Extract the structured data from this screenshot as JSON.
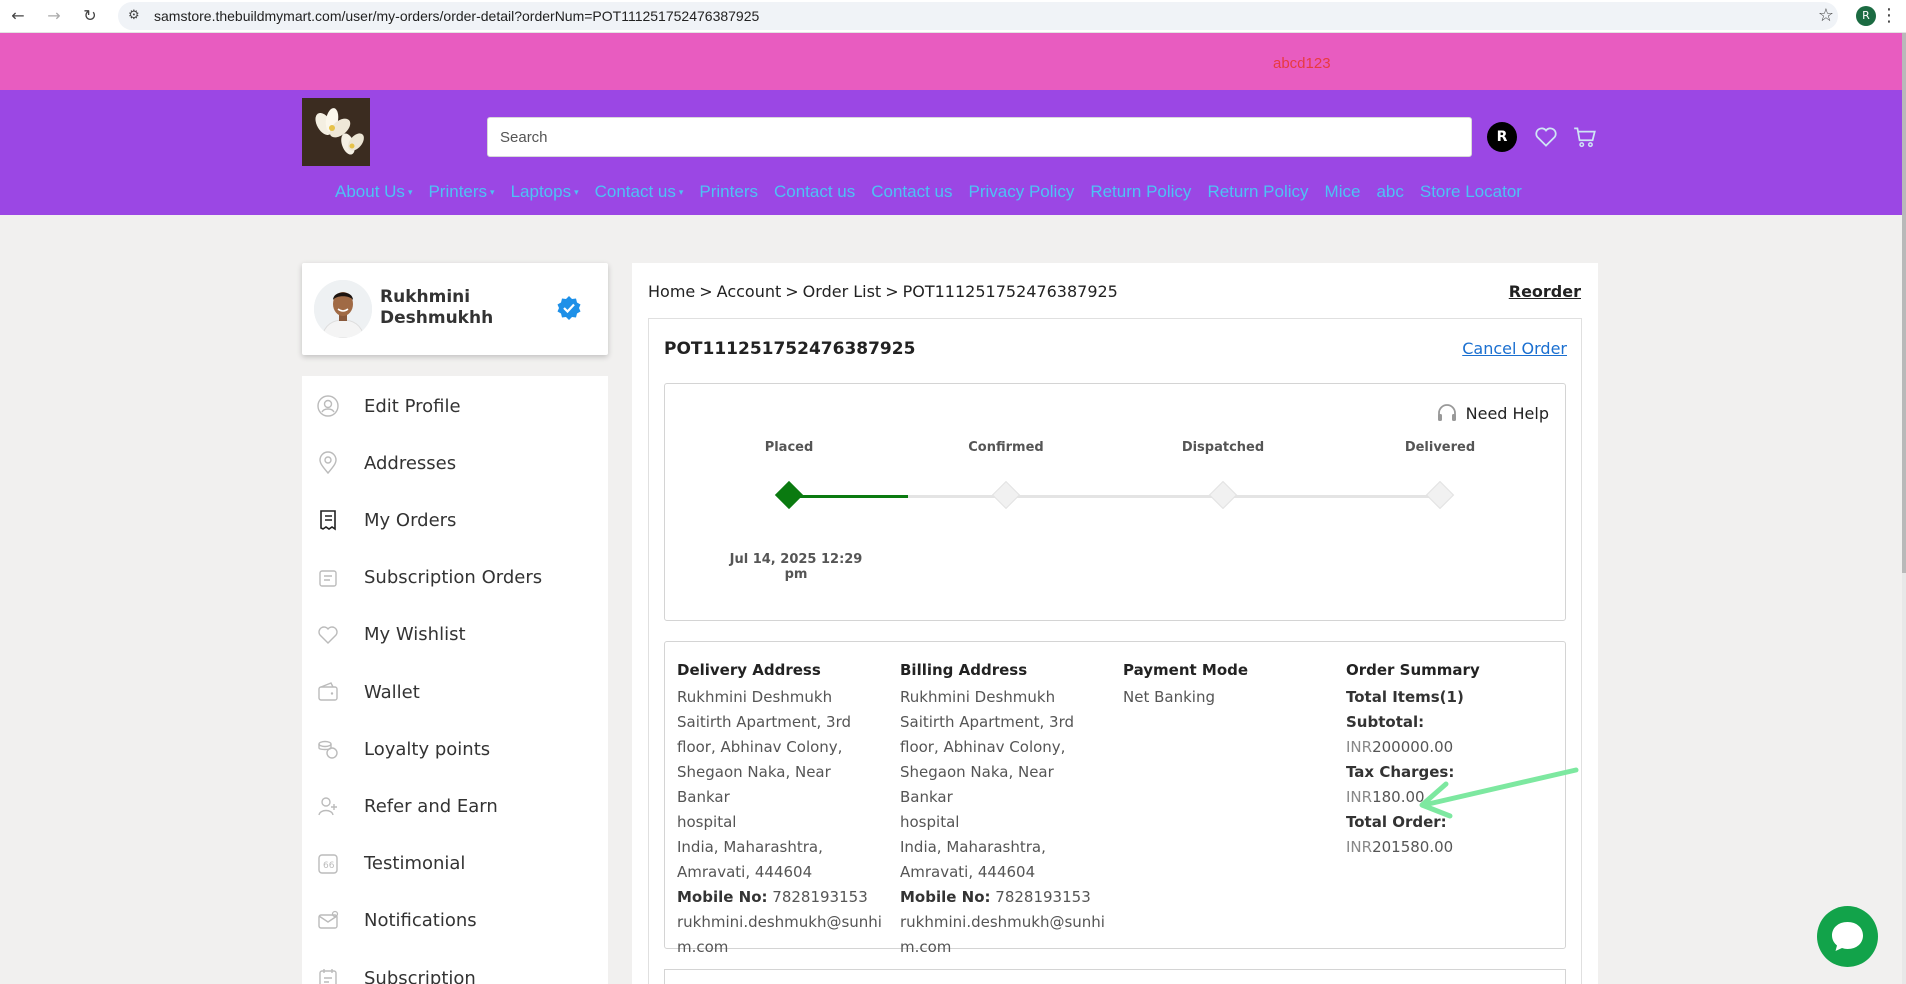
{
  "browser": {
    "url": "samstore.thebuildmymart.com/user/my-orders/order-detail?orderNum=POT111251752476387925",
    "profile_initial": "R"
  },
  "banner": {
    "promo_text": "abcd123"
  },
  "header": {
    "search_placeholder": "Search",
    "user_initial": "R",
    "menu": [
      {
        "label": "About Us",
        "has_dropdown": true
      },
      {
        "label": "Printers",
        "has_dropdown": true
      },
      {
        "label": "Laptops",
        "has_dropdown": true
      },
      {
        "label": "Contact us",
        "has_dropdown": true
      },
      {
        "label": "Printers",
        "has_dropdown": false
      },
      {
        "label": "Contact us",
        "has_dropdown": false
      },
      {
        "label": "Contact us",
        "has_dropdown": false
      },
      {
        "label": "Privacy Policy",
        "has_dropdown": false
      },
      {
        "label": "Return Policy",
        "has_dropdown": false
      },
      {
        "label": "Return Policy",
        "has_dropdown": false
      },
      {
        "label": "Mice",
        "has_dropdown": false
      },
      {
        "label": "abc",
        "has_dropdown": false
      },
      {
        "label": "Store Locator",
        "has_dropdown": false
      }
    ],
    "caret": "▾"
  },
  "profile": {
    "name": "Rukhmini Deshmukhh"
  },
  "sidebar": {
    "items": [
      {
        "label": "Edit Profile",
        "icon": "user-icon"
      },
      {
        "label": "Addresses",
        "icon": "location-pin-icon"
      },
      {
        "label": "My Orders",
        "icon": "receipt-icon",
        "active": true
      },
      {
        "label": "Subscription Orders",
        "icon": "subscription-icon"
      },
      {
        "label": "My Wishlist",
        "icon": "heart-icon"
      },
      {
        "label": "Wallet",
        "icon": "wallet-icon"
      },
      {
        "label": "Loyalty points",
        "icon": "coins-icon"
      },
      {
        "label": "Refer and Earn",
        "icon": "refer-icon"
      },
      {
        "label": "Testimonial",
        "icon": "quote-icon"
      },
      {
        "label": "Notifications",
        "icon": "mail-icon"
      },
      {
        "label": "Subscription",
        "icon": "calendar-icon"
      }
    ]
  },
  "breadcrumb": [
    "Home",
    ">",
    "Account",
    ">",
    "Order List",
    ">",
    "POT111251752476387925"
  ],
  "actions": {
    "reorder": "Reorder",
    "cancel_order": "Cancel Order",
    "need_help": "Need Help"
  },
  "order": {
    "number": "POT111251752476387925",
    "steps": [
      "Placed",
      "Confirmed",
      "Dispatched",
      "Delivered"
    ],
    "completed_steps": 1,
    "placed_date": "Jul 14, 2025 12:29 pm"
  },
  "delivery": {
    "title": "Delivery Address",
    "lines": [
      "Rukhmini Deshmukh",
      "Saitirth Apartment, 3rd",
      "floor, Abhinav Colony,",
      "Shegaon Naka, Near Bankar",
      "hospital",
      "India, Maharashtra,",
      "Amravati, 444604"
    ],
    "mobile_label": "Mobile No:",
    "mobile": "7828193153",
    "email_lines": [
      "rukhmini.deshmukh@sunhi",
      "m.com"
    ]
  },
  "billing": {
    "title": "Billing Address",
    "lines": [
      "Rukhmini Deshmukh",
      "Saitirth Apartment, 3rd",
      "floor, Abhinav Colony,",
      "Shegaon Naka, Near Bankar",
      "hospital",
      "India, Maharashtra,",
      "Amravati, 444604"
    ],
    "mobile_label": "Mobile No:",
    "mobile": "7828193153",
    "email_lines": [
      "rukhmini.deshmukh@sunhi",
      "m.com"
    ]
  },
  "payment": {
    "title": "Payment Mode",
    "mode": "Net Banking"
  },
  "summary": {
    "title": "Order Summary",
    "total_items": "Total Items(1)",
    "subtotal_label": "Subtotal:",
    "subtotal_currency": "INR",
    "subtotal_value": "200000.00",
    "tax_label": "Tax Charges:",
    "tax_currency": "INR",
    "tax_value": "180.00",
    "total_label": "Total Order:",
    "total_currency": "INR",
    "total_value": "201580.00"
  },
  "colors": {
    "banner": "#e85cc0",
    "header": "#9b47e4",
    "menu_link": "#4dc3f4",
    "progress": "#0a7a10",
    "annotation_arrow": "#7de8a0",
    "chat": "#12a34a"
  }
}
